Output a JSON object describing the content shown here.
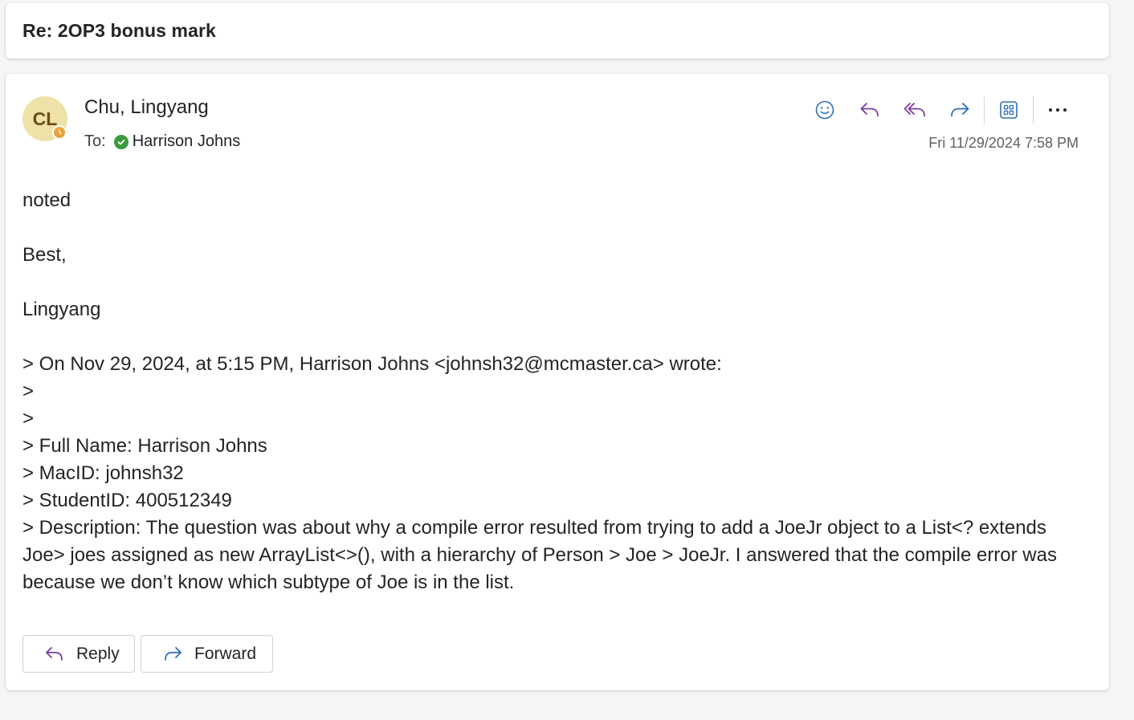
{
  "subject": "Re: 2OP3 bonus mark",
  "sender": {
    "initials": "CL",
    "name": "Chu, Lingyang",
    "avatar_color": "#efe2a9",
    "presence_color": "#e8a33a"
  },
  "recipient": {
    "to_label": "To:",
    "name": "Harrison Johns",
    "status_color": "#3b9a3b"
  },
  "toolbar": {
    "icons": [
      "emoji-icon",
      "reply-icon",
      "reply-all-icon",
      "forward-icon",
      "apps-icon",
      "more-icon"
    ]
  },
  "timestamp": "Fri 11/29/2024 7:58 PM",
  "body": {
    "lines": [
      "noted",
      "",
      "Best,",
      "",
      "Lingyang",
      "",
      "> On Nov 29, 2024, at 5:15 PM, Harrison Johns <johnsh32@mcmaster.ca> wrote:",
      ">",
      ">",
      "> Full Name: Harrison Johns",
      "> MacID: johnsh32",
      "> StudentID: 400512349",
      "> Description: The question was about why a compile error resulted from trying to add a JoeJr object to a List<? extends Joe> joes assigned as new ArrayList<>(), with a hierarchy of Person > Joe > JoeJr. I answered that the compile error was because we don’t know which subtype of Joe is in the list."
    ]
  },
  "actions": {
    "reply_label": "Reply",
    "forward_label": "Forward"
  },
  "colors": {
    "accent_purple": "#7b3d9a",
    "accent_blue": "#2f6fb8"
  }
}
